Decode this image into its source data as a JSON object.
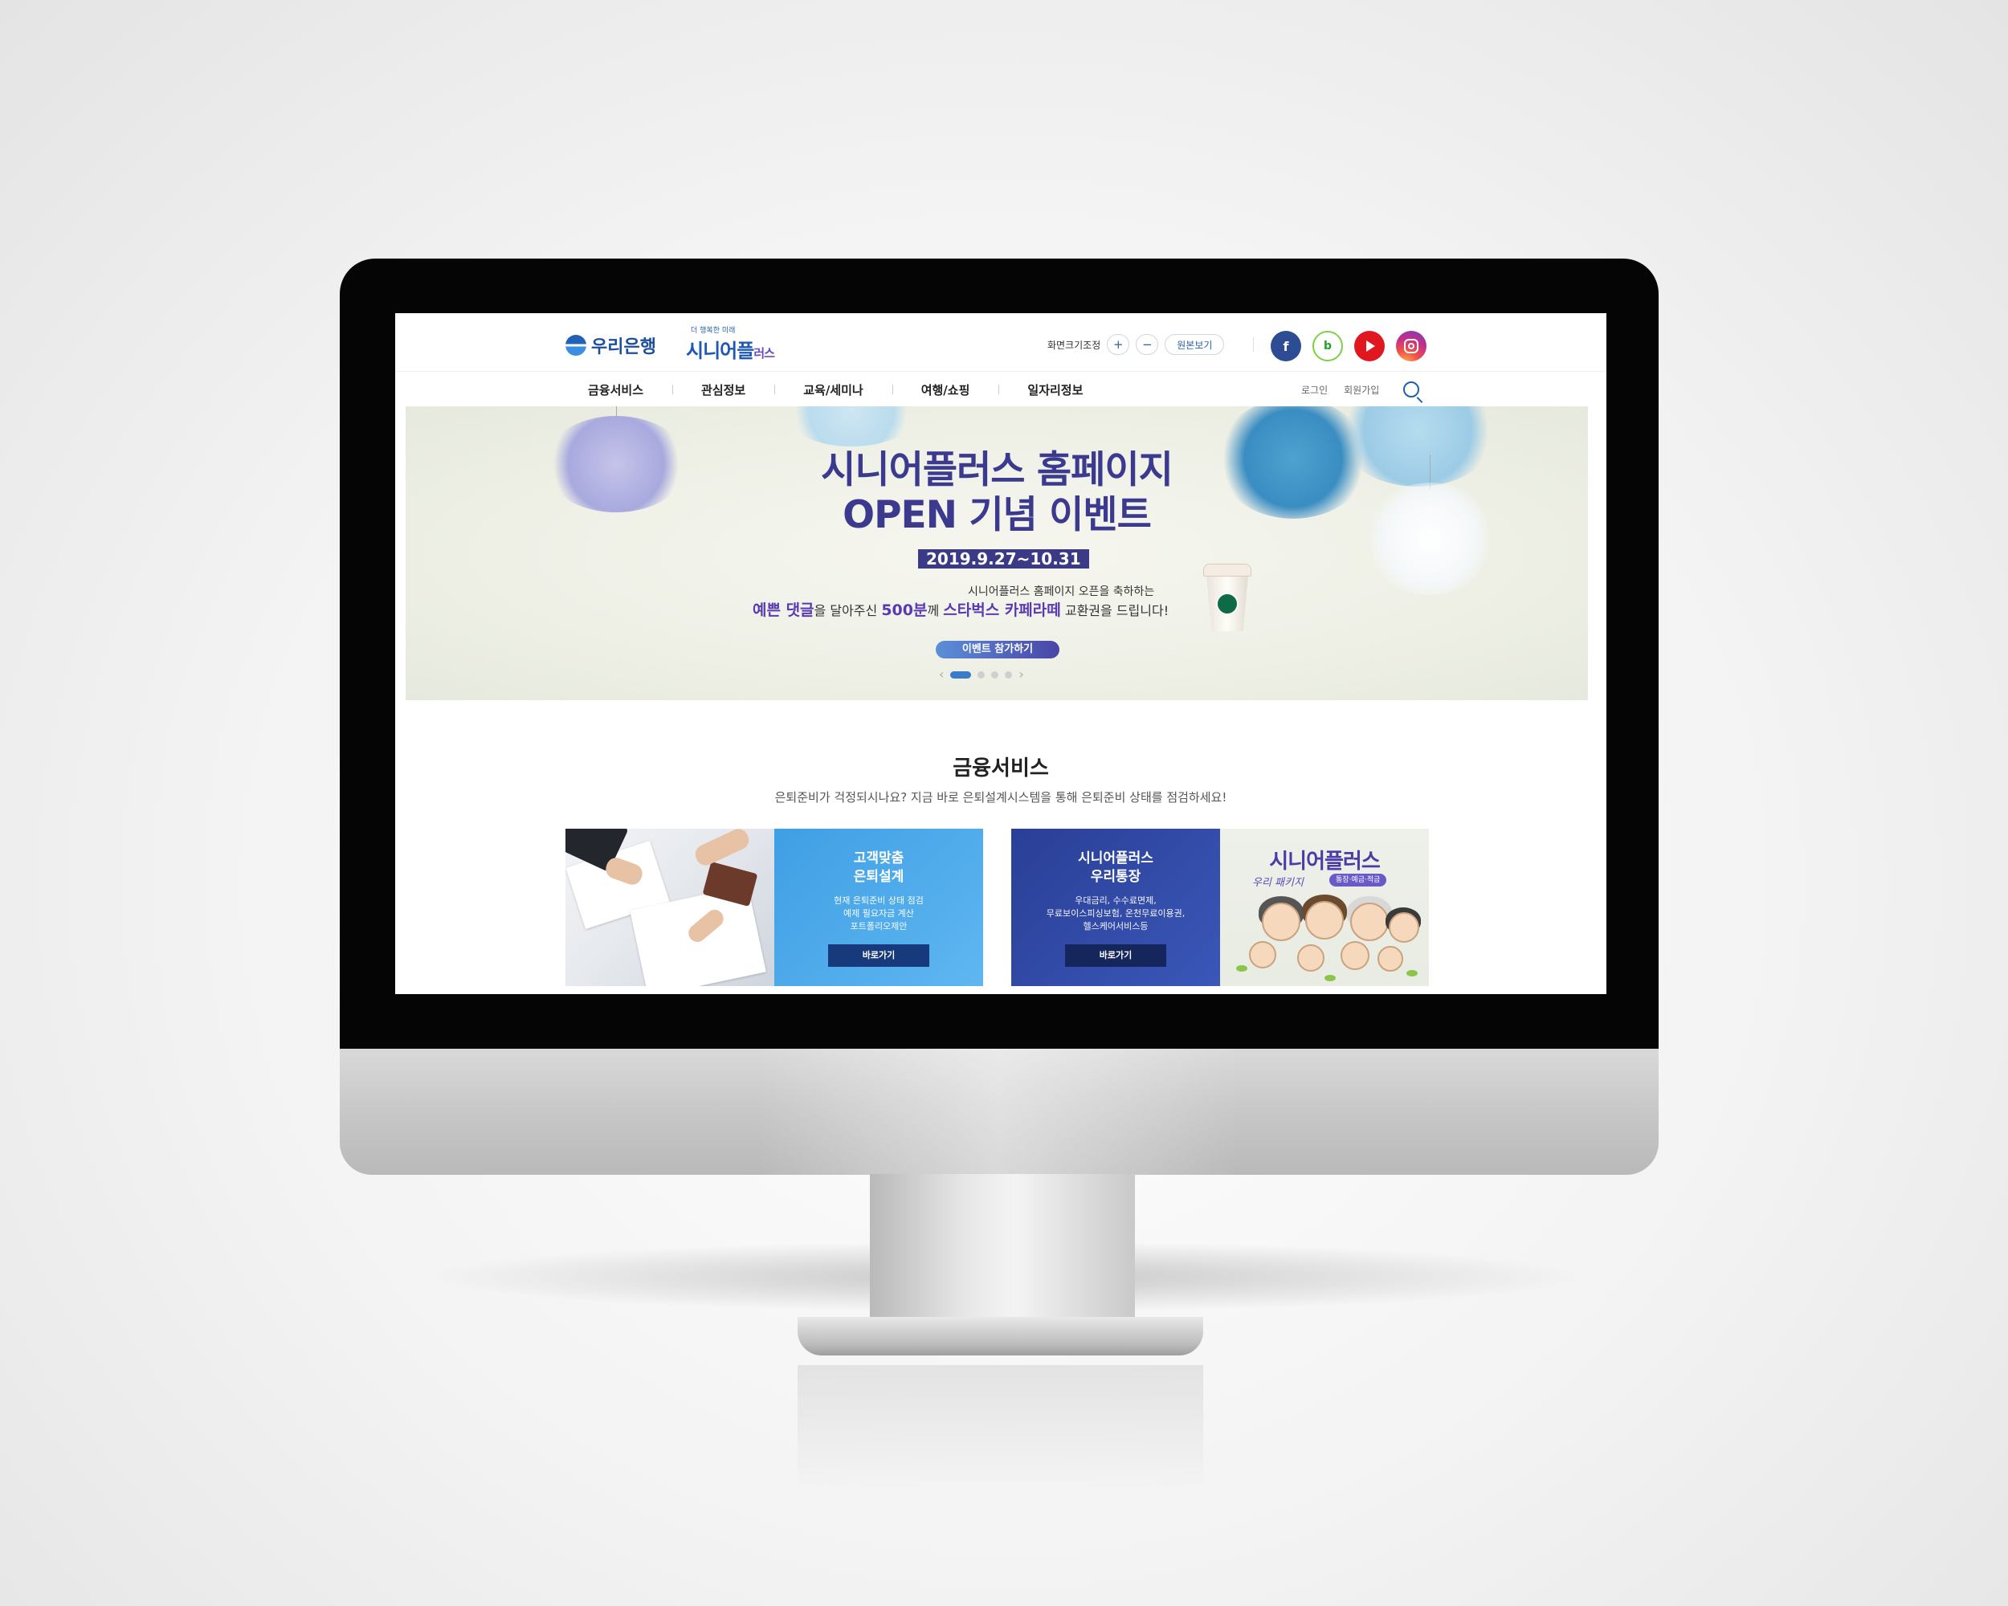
{
  "header": {
    "bank_logo": "우리은행",
    "service_tagline": "더 행복한 미래",
    "service_logo_main": "시니어플",
    "service_logo_small": "러스",
    "font_size_label": "화면크기조정",
    "font_plus": "+",
    "font_minus": "−",
    "original_size": "원본보기",
    "social": [
      {
        "name": "facebook",
        "glyph": "f"
      },
      {
        "name": "blog",
        "glyph": "b"
      },
      {
        "name": "youtube",
        "glyph": ""
      },
      {
        "name": "instagram",
        "glyph": ""
      }
    ]
  },
  "nav": {
    "items": [
      "금융서비스",
      "관심정보",
      "교육/세미나",
      "여행/쇼핑",
      "일자리정보"
    ],
    "login": "로그인",
    "signup": "회원가입"
  },
  "banner": {
    "title_line1": "시니어플러스 홈페이지",
    "title_line2": "OPEN 기념 이벤트",
    "period": "2019.9.27~10.31",
    "desc_line1": "시니어플러스 홈페이지 오픈을 축하하는",
    "desc_part1": "예쁜 댓글",
    "desc_part2": "을 달아주신 ",
    "desc_part3": "500분",
    "desc_part4": "께 ",
    "desc_part5": "스타벅스 카페라떼",
    "desc_part6": " 교환권을 드립니다!",
    "button": "이벤트 참가하기",
    "prev": "‹",
    "next": "›",
    "slide_count": 5,
    "active_slide": 1
  },
  "finance": {
    "title": "금융서비스",
    "subtitle": "은퇴준비가 걱정되시나요? 지금 바로 은퇴설계시스템을 통해 은퇴준비 상태를 점검하세요!",
    "card1": {
      "title_line1": "고객맞춤",
      "title_line2": "은퇴설계",
      "desc_line1": "현재 은퇴준비 상태 점검",
      "desc_line2": "예제 필요자금 계산",
      "desc_line3": "포트폴리오제안",
      "button": "바로가기"
    },
    "card2": {
      "title_line1": "시니어플러스",
      "title_line2": "우리통장",
      "desc_line1": "우대금리, 수수료면제,",
      "desc_line2": "무료보이스피싱보험, 온천무료이용권,",
      "desc_line3": "헬스케어서비스등",
      "button": "바로가기",
      "illustration_title": "시니어플러스",
      "illustration_sub": "우리 패키지",
      "illustration_pill": "통장·예금·적금"
    }
  },
  "colors": {
    "brand_blue": "#1b4f9c",
    "banner_title": "#3b3a8f",
    "card1_panel": "#3f9fe4",
    "card2_panel": "#2a3f96",
    "button_gradient_start": "#5b8fd8",
    "button_gradient_end": "#4a45a8"
  }
}
